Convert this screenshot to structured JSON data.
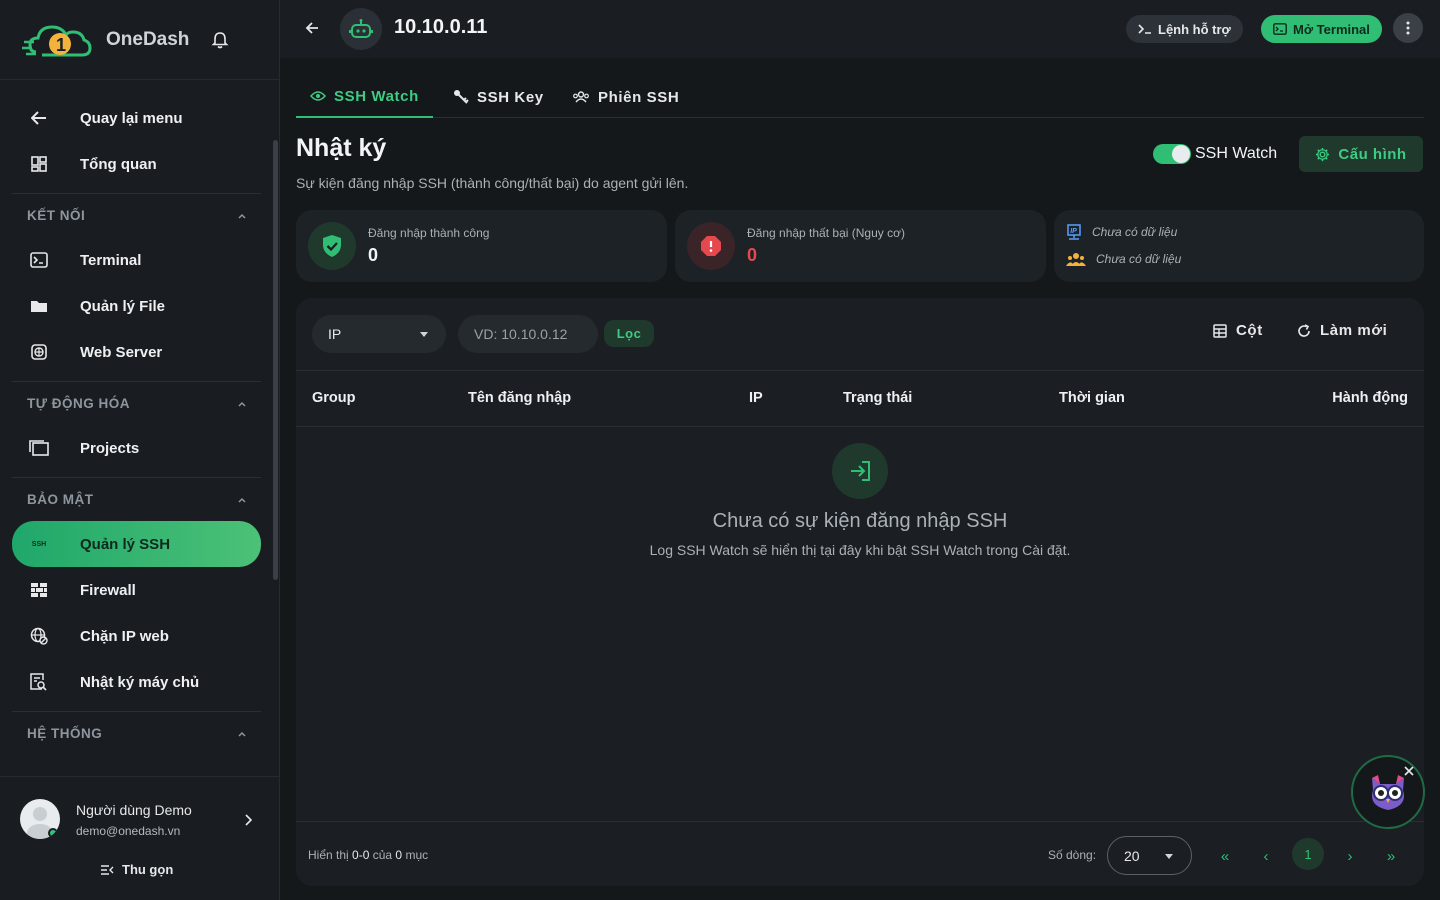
{
  "brand": {
    "name": "OneDash"
  },
  "sidebar": {
    "top_items": [
      {
        "label": "Quay lại menu",
        "icon": "arrow-left-icon"
      },
      {
        "label": "Tổng quan",
        "icon": "dashboard-icon"
      }
    ],
    "sections": [
      {
        "title": "KẾT NỐI",
        "items": [
          {
            "label": "Terminal",
            "icon": "terminal-icon"
          },
          {
            "label": "Quản lý File",
            "icon": "folder-icon"
          },
          {
            "label": "Web Server",
            "icon": "web-server-icon"
          }
        ]
      },
      {
        "title": "TỰ ĐỘNG HÓA",
        "items": [
          {
            "label": "Projects",
            "icon": "projects-icon"
          }
        ]
      },
      {
        "title": "BẢO MẬT",
        "items": [
          {
            "label": "Quản lý SSH",
            "icon": "ssh-icon",
            "badge": "SSH",
            "active": true
          },
          {
            "label": "Firewall",
            "icon": "firewall-icon"
          },
          {
            "label": "Chặn IP web",
            "icon": "globe-block-icon"
          },
          {
            "label": "Nhật ký máy chủ",
            "icon": "log-search-icon"
          }
        ]
      },
      {
        "title": "HỆ THỐNG",
        "items": []
      }
    ]
  },
  "user": {
    "name": "Người dùng Demo",
    "email": "demo@onedash.vn",
    "collapse_label": "Thu gọn"
  },
  "topbar": {
    "host": "10.10.0.11",
    "help_label": "Lệnh hỗ trợ",
    "terminal_label": "Mở Terminal"
  },
  "tabs": [
    {
      "label": "SSH Watch",
      "icon": "eye-icon",
      "active": true
    },
    {
      "label": "SSH Key",
      "icon": "key-icon"
    },
    {
      "label": "Phiên SSH",
      "icon": "users-icon"
    }
  ],
  "page": {
    "title": "Nhật ký",
    "subtitle": "Sự kiện đăng nhập SSH (thành công/thất bại) do agent gửi lên.",
    "toggle_label": "SSH Watch",
    "toggle_on": true,
    "config_label": "Cấu hình"
  },
  "stats": {
    "success": {
      "label": "Đăng nhập thành công",
      "value": "0"
    },
    "failed": {
      "label": "Đăng nhập thất bại (Nguy cơ)",
      "value": "0"
    },
    "info": {
      "line1": "Chưa có dữ liệu",
      "line2": "Chưa có dữ liệu"
    }
  },
  "filter": {
    "field": "IP",
    "placeholder": "VD: 10.10.0.12",
    "apply_label": "Lọc",
    "columns_label": "Cột",
    "refresh_label": "Làm mới"
  },
  "table": {
    "columns": [
      "Group",
      "Tên đăng nhập",
      "IP",
      "Trạng thái",
      "Thời gian",
      "Hành động"
    ],
    "empty_title": "Chưa có sự kiện đăng nhập SSH",
    "empty_subtitle": "Log SSH Watch sẽ hiển thị tại đây khi bật SSH Watch trong Cài đặt."
  },
  "pagination": {
    "showing_prefix": "Hiển thị",
    "range": "0-0",
    "of": "của",
    "total": "0",
    "unit": "mục",
    "rows_label": "Số dòng:",
    "rows_value": "20",
    "current_page": "1",
    "first": "«",
    "prev": "‹",
    "next": "›",
    "last": "»"
  },
  "colors": {
    "accent": "#2fbe74",
    "danger": "#e5484d",
    "bg": "#14181b"
  }
}
